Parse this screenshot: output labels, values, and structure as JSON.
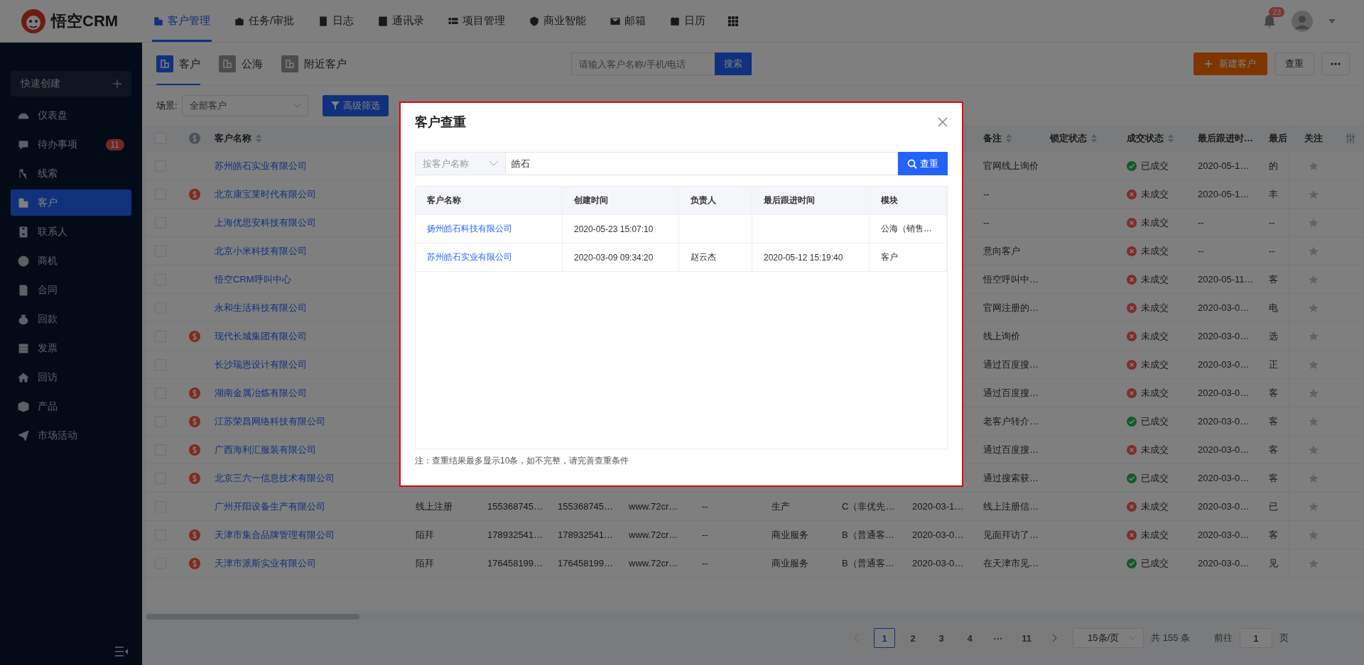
{
  "topbar": {
    "logo_text": "悟空CRM",
    "nav": [
      {
        "label": "客户管理",
        "selected": true
      },
      {
        "label": "任务/审批",
        "selected": false
      },
      {
        "label": "日志",
        "selected": false
      },
      {
        "label": "通讯录",
        "selected": false
      },
      {
        "label": "项目管理",
        "selected": false
      },
      {
        "label": "商业智能",
        "selected": false
      },
      {
        "label": "邮箱",
        "selected": false
      },
      {
        "label": "日历",
        "selected": false
      }
    ],
    "notification_count": "23"
  },
  "sidebar": {
    "quick_create": "快速创建",
    "items": [
      {
        "label": "仪表盘",
        "selected": false
      },
      {
        "label": "待办事项",
        "selected": false,
        "badge": "11"
      },
      {
        "label": "线索",
        "selected": false
      },
      {
        "label": "客户",
        "selected": true
      },
      {
        "label": "联系人",
        "selected": false
      },
      {
        "label": "商机",
        "selected": false
      },
      {
        "label": "合同",
        "selected": false
      },
      {
        "label": "回款",
        "selected": false
      },
      {
        "label": "发票",
        "selected": false
      },
      {
        "label": "回访",
        "selected": false
      },
      {
        "label": "产品",
        "selected": false
      },
      {
        "label": "市场活动",
        "selected": false
      }
    ]
  },
  "tabs": [
    {
      "label": "客户",
      "selected": true
    },
    {
      "label": "公海",
      "selected": false
    },
    {
      "label": "附近客户",
      "selected": false
    }
  ],
  "search": {
    "placeholder": "请输入客户名称/手机/电话",
    "button": "搜索"
  },
  "actions": {
    "create": "新建客户",
    "dedupe": "查重"
  },
  "filter": {
    "label": "场景:",
    "scene": "全部客户",
    "advanced": "高级筛选"
  },
  "table": {
    "all_checked": false,
    "columns": [
      {
        "label": "客户名称",
        "sortable": true
      },
      {
        "label": "备注",
        "sortable": true
      },
      {
        "label": "锁定状态",
        "sortable": true
      },
      {
        "label": "成交状态",
        "sortable": true
      },
      {
        "label": "最后跟进时…",
        "sortable": false
      },
      {
        "label": "最后"
      }
    ],
    "follow_label": "关注",
    "rows": [
      {
        "checked": false,
        "name": "苏州皓石实业有限公司",
        "has_deal": false,
        "note": "官网线上询价",
        "deal": {
          "text": "已成交",
          "won": true
        },
        "last_follow": "2020-05-1…",
        "column_16": "的"
      },
      {
        "checked": false,
        "name": "北京康宝莱时代有限公司",
        "has_deal": true,
        "note": "--",
        "deal": {
          "text": "未成交",
          "won": false
        },
        "last_follow": "2020-05-1…",
        "column_16": "丰"
      },
      {
        "checked": false,
        "name": "上海优思安科技有限公司",
        "has_deal": false,
        "note": "--",
        "deal": {
          "text": "未成交",
          "won": false
        },
        "last_follow": "--",
        "column_16": "--"
      },
      {
        "checked": false,
        "name": "北京小米科技有限公司",
        "has_deal": false,
        "note": "意向客户",
        "deal": {
          "text": "未成交",
          "won": false
        },
        "last_follow": "--",
        "column_16": "--"
      },
      {
        "checked": false,
        "name": "悟空CRM呼叫中心",
        "has_deal": false,
        "note": "悟空呼叫中…",
        "deal": {
          "text": "未成交",
          "won": false
        },
        "last_follow": "2020-05-11…",
        "column_16": "客"
      },
      {
        "checked": false,
        "name": "永和生活科技有限公司",
        "has_deal": false,
        "note": "官网注册的…",
        "deal": {
          "text": "未成交",
          "won": false
        },
        "last_follow": "2020-03-0…",
        "column_16": "电"
      },
      {
        "checked": false,
        "name": "现代长城集团有限公司",
        "has_deal": true,
        "note": "线上询价",
        "deal": {
          "text": "未成交",
          "won": false
        },
        "last_follow": "2020-03-0…",
        "column_16": "选"
      },
      {
        "checked": false,
        "name": "长沙瑞恩设计有限公司",
        "has_deal": false,
        "note": "通过百度搜…",
        "deal": {
          "text": "未成交",
          "won": false
        },
        "last_follow": "2020-03-0…",
        "column_16": "正"
      },
      {
        "checked": false,
        "name": "湖南金属冶炼有限公司",
        "has_deal": true,
        "note": "通过百度搜…",
        "deal": {
          "text": "未成交",
          "won": false
        },
        "last_follow": "2020-03-0…",
        "column_16": "客"
      },
      {
        "checked": false,
        "name": "江苏荣昌网络科技有限公司",
        "has_deal": true,
        "note": "老客户转介…",
        "deal": {
          "text": "已成交",
          "won": true
        },
        "last_follow": "2020-03-0…",
        "column_16": "客"
      },
      {
        "checked": false,
        "name": "广西海利汇服装有限公司",
        "has_deal": true,
        "note": "通过百度搜…",
        "deal": {
          "text": "未成交",
          "won": false
        },
        "last_follow": "2020-03-0…",
        "column_16": "客"
      },
      {
        "checked": false,
        "name": "北京三六一信息技术有限公司",
        "has_deal": true,
        "note": "通过搜索获…",
        "deal": {
          "text": "已成交",
          "won": true
        },
        "last_follow": "2020-03-0…",
        "column_16": "客"
      },
      {
        "checked": false,
        "name": "广州开阳设备生产有限公司",
        "has_deal": false,
        "column_4": "线上注册",
        "column_5": "155368745…",
        "column_6": "155368745…",
        "column_7": "www.72cr…",
        "column_8": "--",
        "column_9": "生产",
        "column_10": "C（非优先…",
        "column_11": "2020-03-1…",
        "note": "线上注册信…",
        "deal": {
          "text": "未成交",
          "won": false
        },
        "last_follow": "2020-03-0…",
        "column_16": "已"
      },
      {
        "checked": false,
        "name": "天津市集合品牌管理有限公司",
        "has_deal": true,
        "column_4": "陌拜",
        "column_5": "178932541…",
        "column_6": "178932541…",
        "column_7": "www.72cr…",
        "column_8": "--",
        "column_9": "商业服务",
        "column_10": "B（普通客…",
        "column_11": "2020-03-0…",
        "note": "见面拜访了…",
        "deal": {
          "text": "未成交",
          "won": false
        },
        "last_follow": "2020-03-0…",
        "column_16": "客"
      },
      {
        "checked": false,
        "name": "天津市派斯实业有限公司",
        "has_deal": true,
        "column_4": "陌拜",
        "column_5": "176458199…",
        "column_6": "176458199…",
        "column_7": "www.72cr…",
        "column_8": "--",
        "column_9": "商业服务",
        "column_10": "B（普通客…",
        "column_11": "2020-03-0…",
        "note": "在天津市见…",
        "deal": {
          "text": "已成交",
          "won": true
        },
        "last_follow": "2020-03-0…",
        "column_16": "见"
      }
    ]
  },
  "pagination": {
    "pages": [
      {
        "label": "1",
        "selected": true
      },
      {
        "label": "2",
        "selected": false
      },
      {
        "label": "3",
        "selected": false
      },
      {
        "label": "4",
        "selected": false
      },
      {
        "label": "···",
        "selected": false
      },
      {
        "label": "11",
        "selected": false
      }
    ],
    "page_size": "15条/页",
    "total": "共 155 条",
    "goto_label": "前往",
    "goto_value": "1",
    "page_unit": "页"
  },
  "dialog": {
    "title": "客户查重",
    "search_by": "按客户名称",
    "query": "皓石",
    "button": "查重",
    "columns": [
      "客户名称",
      "创建时间",
      "负责人",
      "最后跟进时间",
      "模块"
    ],
    "rows": [
      {
        "customer": "扬州皓石科技有限公司",
        "created": "2020-05-23 15:07:10",
        "module": "公海（销售…"
      },
      {
        "customer": "苏州皓石实业有限公司",
        "created": "2020-03-09 09:34:20",
        "owner": "赵云杰",
        "last_follow": "2020-05-12 15:19:40",
        "module": "客户"
      }
    ],
    "note": "注：查重结果最多显示10条，如不完整，请完善查重条件"
  }
}
